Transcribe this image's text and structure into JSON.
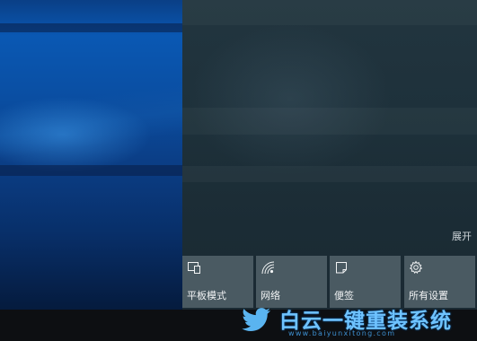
{
  "action_center": {
    "expand_label": "展开",
    "tiles": [
      {
        "label": "平板模式",
        "icon": "tablet-mode-icon"
      },
      {
        "label": "网络",
        "icon": "network-icon"
      },
      {
        "label": "便签",
        "icon": "note-icon"
      },
      {
        "label": "所有设置",
        "icon": "gear-icon"
      }
    ]
  },
  "watermark": {
    "brand": "白云一键重装系统",
    "url": "www.baiyunxitong.com",
    "logo_icon": "twitter-bird-icon"
  },
  "colors": {
    "tile_bg": "#4a5a62",
    "panel_bg": "#1e313b",
    "wallpaper_blue": "#0a58b3",
    "watermark_blue": "#6fc3ff"
  }
}
